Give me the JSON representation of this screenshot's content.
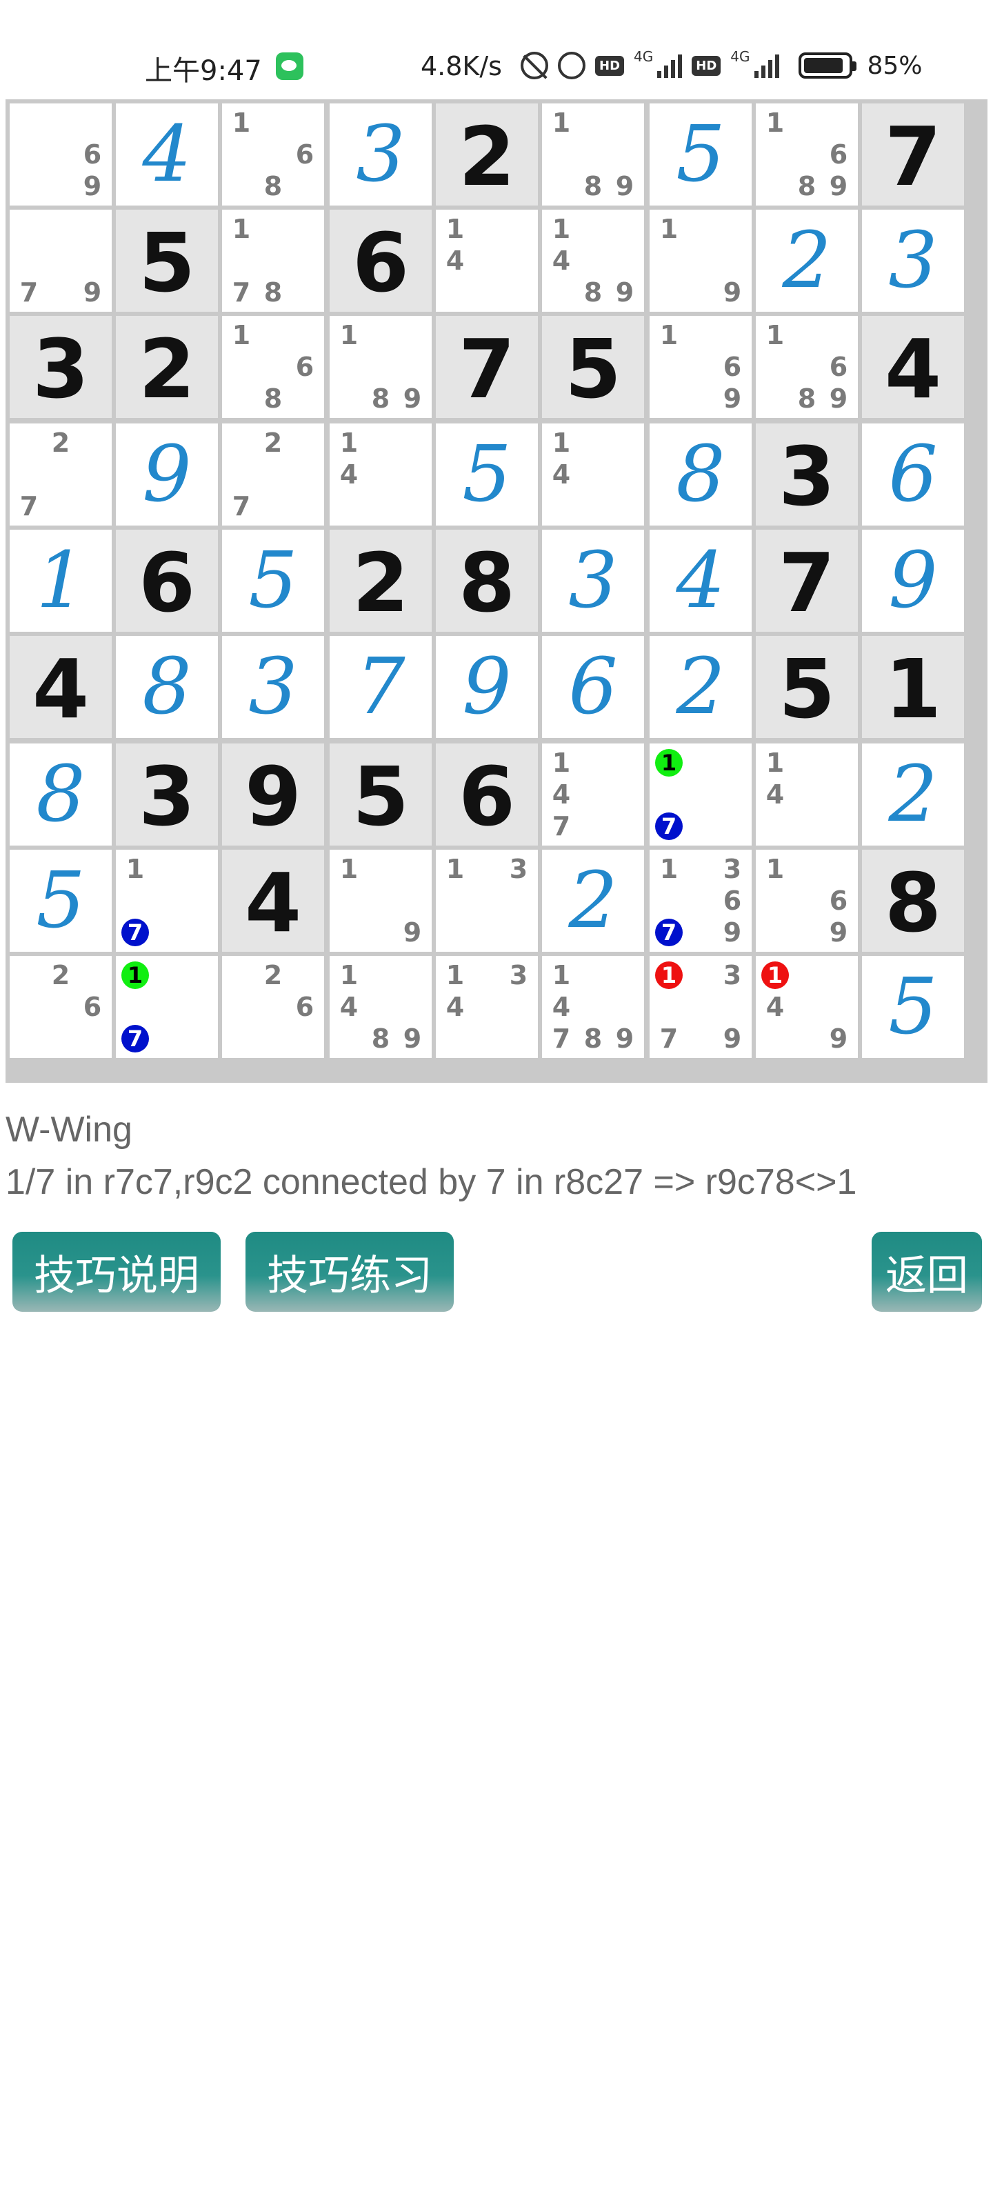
{
  "status_bar": {
    "time": "上午9:47",
    "speed": "4.8K/s",
    "network_badge_1": "HD",
    "network_label_1": "4G",
    "network_badge_2": "HD",
    "network_label_2": "4G",
    "battery": "85%"
  },
  "board": {
    "cells": [
      [
        {
          "c": [
            6,
            9
          ]
        },
        {
          "u": 4
        },
        {
          "c": [
            1,
            6,
            8
          ]
        },
        {
          "u": 3
        },
        {
          "g": 2
        },
        {
          "c": [
            1,
            8,
            9
          ]
        },
        {
          "u": 5
        },
        {
          "c": [
            1,
            6,
            8,
            9
          ]
        },
        {
          "g": 7
        }
      ],
      [
        {
          "c": [
            7,
            9
          ]
        },
        {
          "g": 5
        },
        {
          "c": [
            1,
            7,
            8
          ]
        },
        {
          "g": 6
        },
        {
          "c": [
            1,
            4
          ]
        },
        {
          "c": [
            1,
            4,
            8,
            9
          ]
        },
        {
          "c": [
            1,
            9
          ]
        },
        {
          "u": 2
        },
        {
          "u": 3
        }
      ],
      [
        {
          "g": 3
        },
        {
          "g": 2
        },
        {
          "c": [
            1,
            6,
            8
          ]
        },
        {
          "c": [
            1,
            8,
            9
          ]
        },
        {
          "g": 7
        },
        {
          "g": 5
        },
        {
          "c": [
            1,
            6,
            9
          ]
        },
        {
          "c": [
            1,
            6,
            8,
            9
          ]
        },
        {
          "g": 4
        }
      ],
      [
        {
          "c": [
            2,
            7
          ]
        },
        {
          "u": 9
        },
        {
          "c": [
            2,
            7
          ]
        },
        {
          "c": [
            1,
            4
          ]
        },
        {
          "u": 5
        },
        {
          "c": [
            1,
            4
          ]
        },
        {
          "u": 8
        },
        {
          "g": 3
        },
        {
          "u": 6
        }
      ],
      [
        {
          "u": 1
        },
        {
          "g": 6
        },
        {
          "u": 5
        },
        {
          "g": 2
        },
        {
          "g": 8
        },
        {
          "u": 3
        },
        {
          "u": 4
        },
        {
          "g": 7
        },
        {
          "u": 9
        }
      ],
      [
        {
          "g": 4
        },
        {
          "u": 8
        },
        {
          "u": 3
        },
        {
          "u": 7
        },
        {
          "u": 9
        },
        {
          "u": 6
        },
        {
          "u": 2
        },
        {
          "g": 5
        },
        {
          "g": 1
        }
      ],
      [
        {
          "u": 8
        },
        {
          "g": 3
        },
        {
          "g": 9
        },
        {
          "g": 5
        },
        {
          "g": 6
        },
        {
          "c": [
            1,
            4,
            7
          ]
        },
        {
          "c": [
            1,
            7
          ],
          "m": {
            "1": "green",
            "7": "blue"
          }
        },
        {
          "c": [
            1,
            4
          ]
        },
        {
          "u": 2
        }
      ],
      [
        {
          "u": 5
        },
        {
          "c": [
            1,
            7
          ],
          "m": {
            "7": "blue"
          }
        },
        {
          "g": 4
        },
        {
          "c": [
            1,
            9
          ]
        },
        {
          "c": [
            1,
            3
          ]
        },
        {
          "u": 2
        },
        {
          "c": [
            1,
            3,
            6,
            7,
            9
          ],
          "m": {
            "7": "blue"
          }
        },
        {
          "c": [
            1,
            6,
            9
          ]
        },
        {
          "g": 8
        }
      ],
      [
        {
          "c": [
            2,
            6
          ]
        },
        {
          "c": [
            1,
            7
          ],
          "m": {
            "1": "green",
            "7": "blue"
          }
        },
        {
          "c": [
            2,
            6
          ]
        },
        {
          "c": [
            1,
            4,
            8,
            9
          ]
        },
        {
          "c": [
            1,
            3,
            4
          ]
        },
        {
          "c": [
            1,
            4,
            7,
            8,
            9
          ]
        },
        {
          "c": [
            1,
            3,
            7,
            9
          ],
          "m": {
            "1": "red"
          }
        },
        {
          "c": [
            1,
            4,
            9
          ],
          "m": {
            "1": "red"
          }
        },
        {
          "u": 5
        }
      ]
    ]
  },
  "technique": {
    "name": "W-Wing",
    "description": "1/7 in r7c7,r9c2 connected by 7 in r8c27 => r9c78<>1"
  },
  "buttons": {
    "explain": "技巧说明",
    "practice": "技巧练习",
    "back": "返回"
  },
  "colors": {
    "user_digit": "#2288cc",
    "given_bg": "#e5e5e5",
    "button_teal": "#1f8b83",
    "mark_green": "#11ee11",
    "mark_blue": "#0011cc",
    "mark_red": "#ee1111"
  }
}
